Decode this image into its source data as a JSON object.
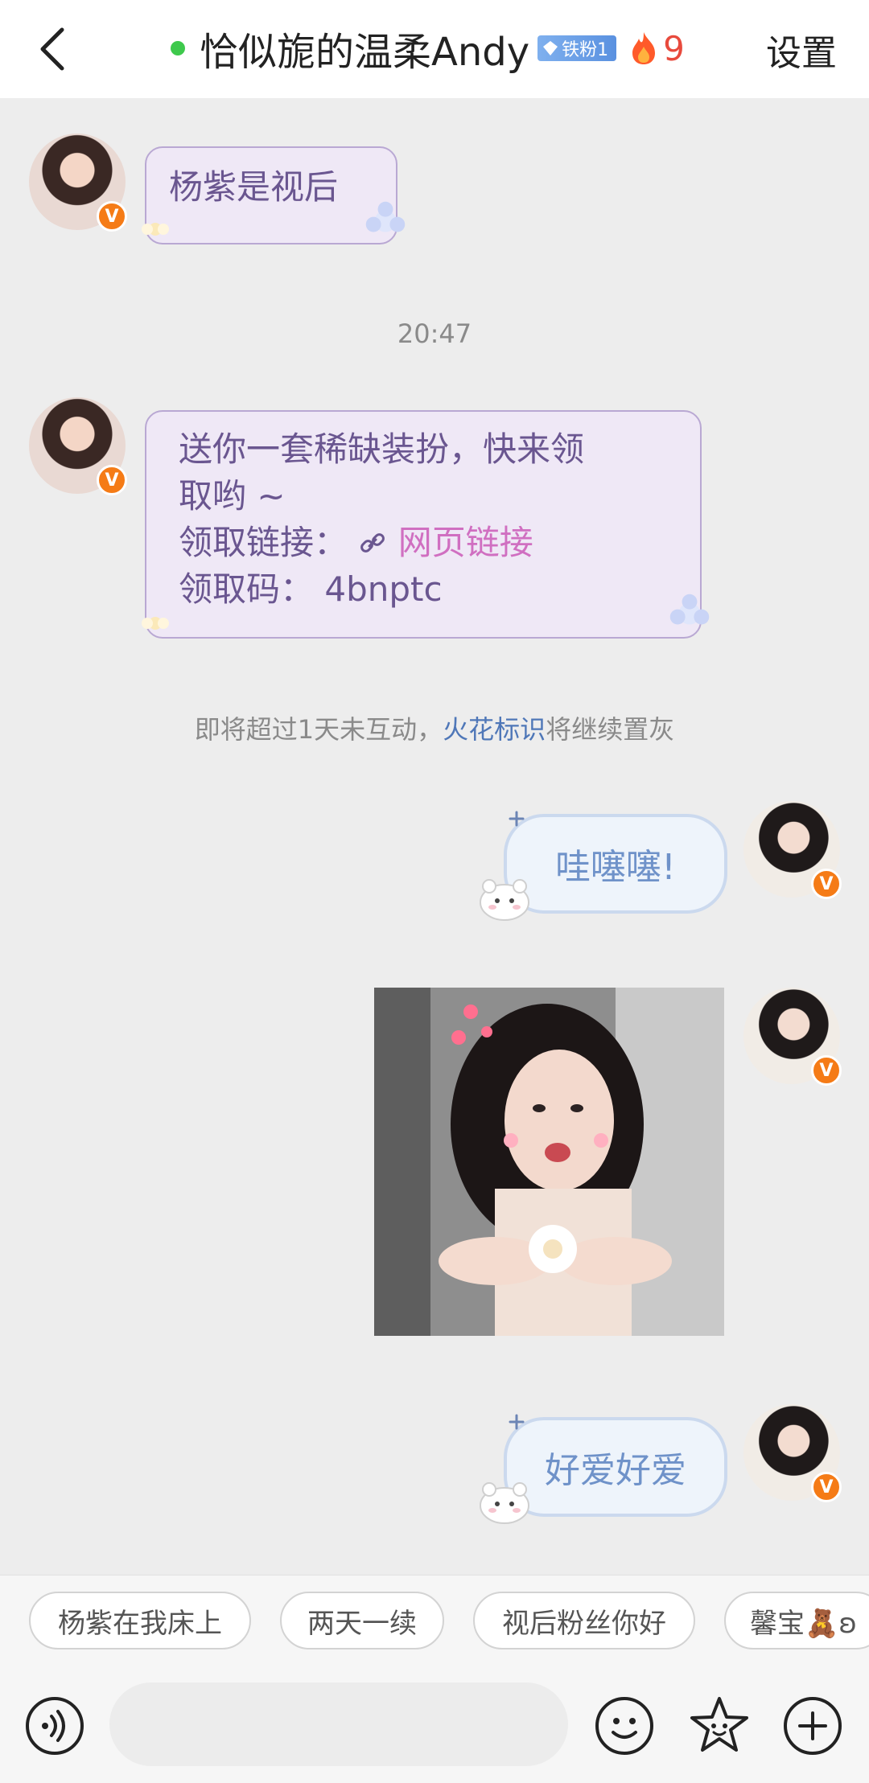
{
  "header": {
    "title": "恰似旎的温柔Andy",
    "badge": "铁粉1",
    "fire_count": "9",
    "settings_label": "设置"
  },
  "messages": {
    "m1_text": "杨紫是视后",
    "time": "20:47",
    "m2_line1": "送你一套稀缺装扮，快来领",
    "m2_line2": "取哟 ~",
    "m2_link_prefix": "领取链接：",
    "m2_link_text": "网页链接",
    "m2_code_prefix": "领取码：",
    "m2_code": "4bnptc",
    "notice_before": "即将超过1天未互动，",
    "notice_link": "火花标识",
    "notice_after": "将继续置灰",
    "m3_text": "哇噻噻!",
    "m5_text": "好爱好爱"
  },
  "quick_replies": [
    "杨紫在我床上",
    "两天一续",
    "视后粉丝你好",
    "馨宝🧸ʚ"
  ],
  "input": {
    "placeholder": ""
  },
  "colors": {
    "online": "#3ec94c",
    "fire": "#e84a3d",
    "link": "#4f77b8",
    "verified": "#f57b16"
  }
}
